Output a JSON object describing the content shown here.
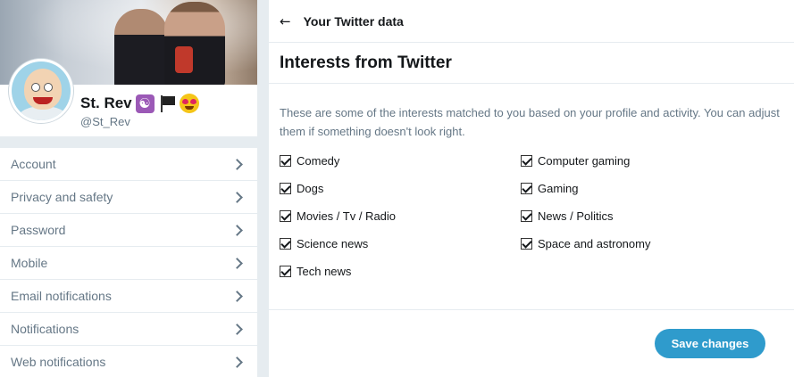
{
  "profile": {
    "name": "St. Rev",
    "handle": "@St_Rev",
    "name_emoji_icons": [
      "yin-yang-icon",
      "black-flag-icon",
      "heart-eyes-icon"
    ]
  },
  "menu": {
    "items": [
      {
        "label": "Account"
      },
      {
        "label": "Privacy and safety"
      },
      {
        "label": "Password"
      },
      {
        "label": "Mobile"
      },
      {
        "label": "Email notifications"
      },
      {
        "label": "Notifications"
      },
      {
        "label": "Web notifications"
      }
    ]
  },
  "header": {
    "back_icon": "arrow-left-icon",
    "title": "Your Twitter data"
  },
  "section": {
    "title": "Interests from Twitter",
    "description": "These are some of the interests matched to you based on your profile and activity. You can adjust them if something doesn't look right."
  },
  "interests": [
    {
      "label": "Comedy",
      "checked": true
    },
    {
      "label": "Computer gaming",
      "checked": true
    },
    {
      "label": "Dogs",
      "checked": true
    },
    {
      "label": "Gaming",
      "checked": true
    },
    {
      "label": "Movies / Tv / Radio",
      "checked": true
    },
    {
      "label": "News / Politics",
      "checked": true
    },
    {
      "label": "Science news",
      "checked": true
    },
    {
      "label": "Space and astronomy",
      "checked": true
    },
    {
      "label": "Tech news",
      "checked": true
    }
  ],
  "actions": {
    "save_label": "Save changes"
  },
  "colors": {
    "accent": "#2f9bcc",
    "background": "#e6ecf0",
    "muted_text": "#657786"
  }
}
